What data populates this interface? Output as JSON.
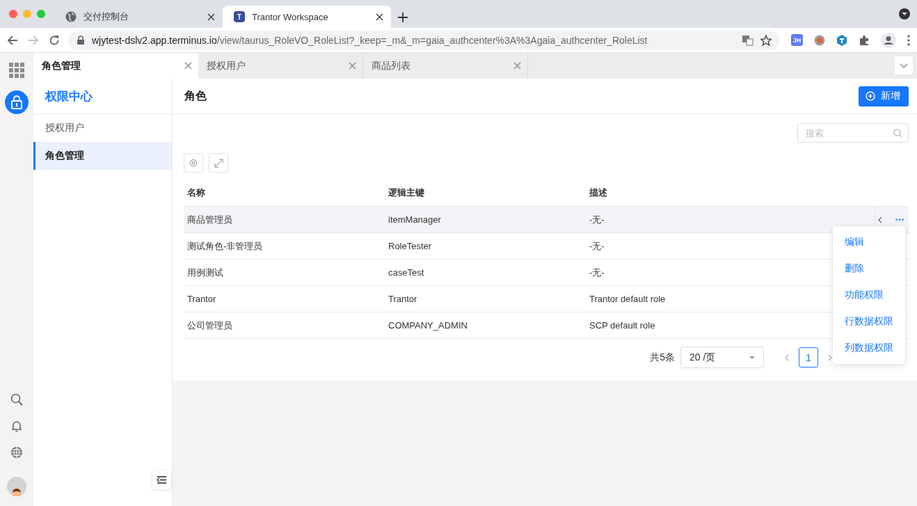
{
  "browser": {
    "tabs": [
      {
        "title": "交付控制台",
        "selected": false,
        "kind": "globe"
      },
      {
        "title": "Trantor Workspace",
        "selected": true,
        "kind": "letter",
        "letter": "T"
      }
    ],
    "url_host": "wjytest-dslv2.app.terminus.io",
    "url_path": "/view/taurus_RoleVO_RoleList?_keep=_m&_m=gaia_authcenter%3A%3Agaia_authcenter_RoleList",
    "extension_badge": "JH"
  },
  "app_tabs": [
    {
      "label": "角色管理",
      "selected": true
    },
    {
      "label": "授权用户",
      "selected": false
    },
    {
      "label": "商品列表",
      "selected": false
    }
  ],
  "sidebar": {
    "title": "权限中心",
    "items": [
      {
        "label": "授权用户",
        "selected": false
      },
      {
        "label": "角色管理",
        "selected": true
      }
    ]
  },
  "page": {
    "title": "角色",
    "add_button": "新增",
    "search": {
      "placeholder": "搜索"
    },
    "table": {
      "columns": [
        "名称",
        "逻辑主键",
        "描述"
      ],
      "rows": [
        {
          "cells": [
            "商品管理员",
            "itemManager",
            "-无-"
          ],
          "highlighted": true
        },
        {
          "cells": [
            "测试角色-非管理员",
            "RoleTester",
            "-无-"
          ],
          "highlighted": false
        },
        {
          "cells": [
            "用例测试",
            "caseTest",
            "-无-"
          ],
          "highlighted": false
        },
        {
          "cells": [
            "Trantor",
            "Trantor",
            "Trantor default role"
          ],
          "highlighted": false
        },
        {
          "cells": [
            "公司管理员",
            "COMPANY_ADMIN",
            "SCP default role"
          ],
          "highlighted": false
        }
      ]
    },
    "pagination": {
      "total": "共5条",
      "page_size": "20 /页",
      "pages": [
        {
          "label": "1",
          "selected": true
        }
      ]
    },
    "row_menu": [
      "编辑",
      "删除",
      "功能权限",
      "行数据权限",
      "列数据权限"
    ]
  }
}
